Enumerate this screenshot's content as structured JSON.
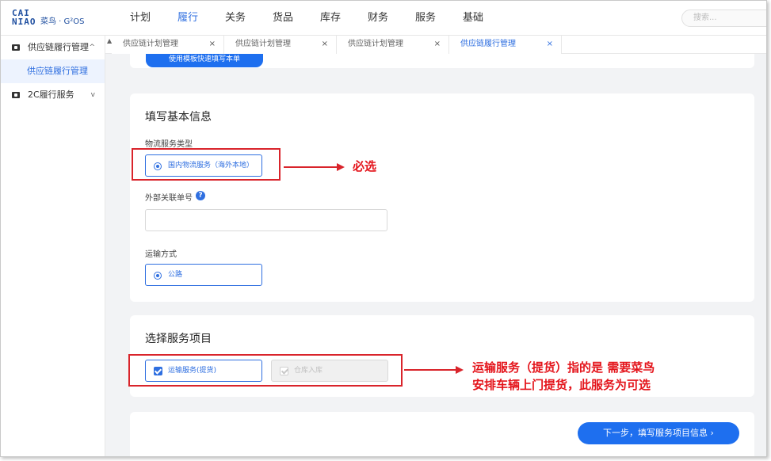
{
  "logo": {
    "line1": "CAI",
    "line2": "NIAO",
    "suffix": "菜鸟 · G²OS"
  },
  "topnav": {
    "items": [
      "计划",
      "履行",
      "关务",
      "货品",
      "库存",
      "财务",
      "服务",
      "基础"
    ],
    "active": "履行"
  },
  "search": {
    "placeholder": "搜索..."
  },
  "sidebar": {
    "group1": {
      "label": "供应链履行管理",
      "chevron": "^"
    },
    "group1_sub": {
      "label": "供应链履行管理"
    },
    "group2": {
      "label": "2C履行服务",
      "chevron": "v"
    }
  },
  "tabs": {
    "arrow": "▲",
    "items": [
      {
        "label": "供应链计划管理",
        "close": "×"
      },
      {
        "label": "供应链计划管理",
        "close": "×"
      },
      {
        "label": "供应链计划管理",
        "close": "×"
      },
      {
        "label": "供应链履行管理",
        "close": "×"
      }
    ]
  },
  "top_card": {
    "template_button": "使用模板快速填写本单"
  },
  "basic_info": {
    "title": "填写基本信息",
    "service_type_label": "物流服务类型",
    "service_type_option": "国内物流服务（海外本地）",
    "external_no_label": "外部关联单号",
    "help": "?",
    "transport_label": "运输方式",
    "transport_option": "公路"
  },
  "service_items": {
    "title": "选择服务项目",
    "option_transport": "运输服务(提货)",
    "option_warehouse": "仓库入库"
  },
  "footer": {
    "next_button": "下一步，填写服务项目信息 ›"
  },
  "annotations": {
    "note1": "必选",
    "note2_line1": "运输服务（提货）指的是 需要菜鸟",
    "note2_line2": "安排车辆上门提货，此服务为可选",
    "color": "#e4141b"
  },
  "colors": {
    "accent": "#2f6fe0",
    "button": "#1e6fef",
    "annotation": "#d9242b",
    "background": "#f2f3f5"
  }
}
